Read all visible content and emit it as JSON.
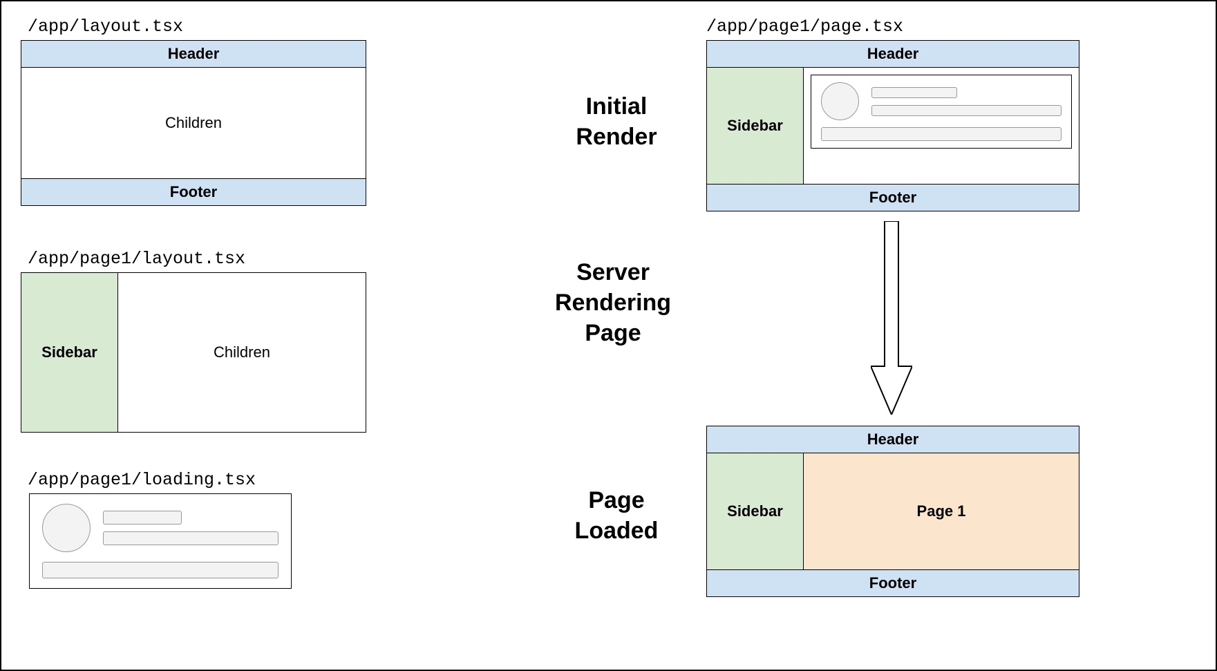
{
  "left": {
    "rootLayout": {
      "path": "/app/layout.tsx",
      "header": "Header",
      "children": "Children",
      "footer": "Footer"
    },
    "page1Layout": {
      "path": "/app/page1/layout.tsx",
      "sidebar": "Sidebar",
      "children": "Children"
    },
    "loading": {
      "path": "/app/page1/loading.tsx"
    }
  },
  "right": {
    "pagePath": "/app/page1/page.tsx",
    "phases": {
      "initialRender": "Initial\nRender",
      "serverRendering": "Server\nRendering\nPage",
      "pageLoaded": "Page\nLoaded"
    },
    "initial": {
      "header": "Header",
      "sidebar": "Sidebar",
      "footer": "Footer"
    },
    "loaded": {
      "header": "Header",
      "sidebar": "Sidebar",
      "content": "Page 1",
      "footer": "Footer"
    }
  },
  "colors": {
    "headerFooter": "#cfe2f3",
    "sidebar": "#d9ead3",
    "page": "#fce5cd",
    "skeleton": "#f3f3f3"
  }
}
